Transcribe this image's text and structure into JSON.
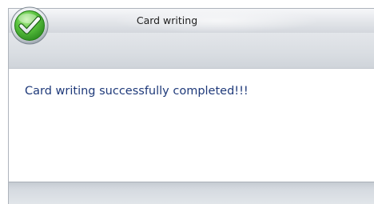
{
  "window": {
    "title": "Card writing"
  },
  "dialog": {
    "message": "Card writing successfully completed!!!",
    "icon": "check-circle-icon",
    "icon_color": "#3fa832"
  },
  "colors": {
    "message_text": "#1f3a7a",
    "title_text": "#1e1e1e"
  }
}
